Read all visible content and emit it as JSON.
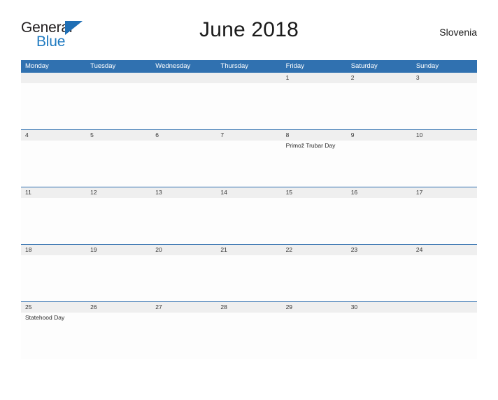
{
  "brand": {
    "name_part1": "General",
    "name_part2": "Blue",
    "triangle_color": "#1f6fb5",
    "blue_color": "#1f7ac0"
  },
  "header": {
    "title": "June 2018",
    "region": "Slovenia"
  },
  "theme": {
    "header_blue": "#3071b0",
    "row_divider_blue": "#2f6fae",
    "date_band_gray": "#efefef",
    "cell_white": "#fdfdfd"
  },
  "calendar": {
    "weekdays": [
      "Monday",
      "Tuesday",
      "Wednesday",
      "Thursday",
      "Friday",
      "Saturday",
      "Sunday"
    ],
    "weeks": [
      {
        "days": [
          {
            "date": "",
            "event": ""
          },
          {
            "date": "",
            "event": ""
          },
          {
            "date": "",
            "event": ""
          },
          {
            "date": "",
            "event": ""
          },
          {
            "date": "1",
            "event": ""
          },
          {
            "date": "2",
            "event": ""
          },
          {
            "date": "3",
            "event": ""
          }
        ]
      },
      {
        "days": [
          {
            "date": "4",
            "event": ""
          },
          {
            "date": "5",
            "event": ""
          },
          {
            "date": "6",
            "event": ""
          },
          {
            "date": "7",
            "event": ""
          },
          {
            "date": "8",
            "event": "Primož Trubar Day"
          },
          {
            "date": "9",
            "event": ""
          },
          {
            "date": "10",
            "event": ""
          }
        ]
      },
      {
        "days": [
          {
            "date": "11",
            "event": ""
          },
          {
            "date": "12",
            "event": ""
          },
          {
            "date": "13",
            "event": ""
          },
          {
            "date": "14",
            "event": ""
          },
          {
            "date": "15",
            "event": ""
          },
          {
            "date": "16",
            "event": ""
          },
          {
            "date": "17",
            "event": ""
          }
        ]
      },
      {
        "days": [
          {
            "date": "18",
            "event": ""
          },
          {
            "date": "19",
            "event": ""
          },
          {
            "date": "20",
            "event": ""
          },
          {
            "date": "21",
            "event": ""
          },
          {
            "date": "22",
            "event": ""
          },
          {
            "date": "23",
            "event": ""
          },
          {
            "date": "24",
            "event": ""
          }
        ]
      },
      {
        "days": [
          {
            "date": "25",
            "event": "Statehood Day"
          },
          {
            "date": "26",
            "event": ""
          },
          {
            "date": "27",
            "event": ""
          },
          {
            "date": "28",
            "event": ""
          },
          {
            "date": "29",
            "event": ""
          },
          {
            "date": "30",
            "event": ""
          },
          {
            "date": "",
            "event": ""
          }
        ]
      }
    ]
  }
}
